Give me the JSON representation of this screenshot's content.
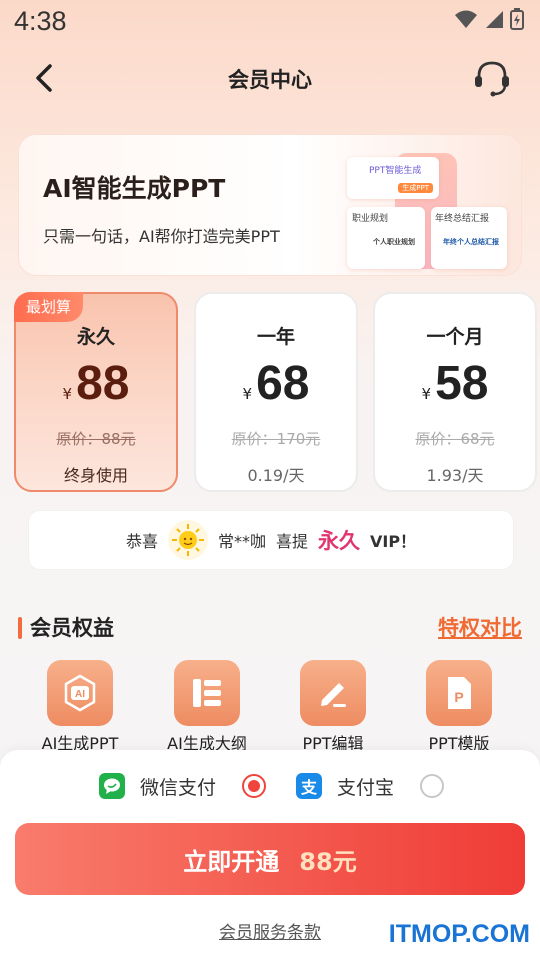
{
  "status": {
    "time": "4:38"
  },
  "nav": {
    "title": "会员中心"
  },
  "banner": {
    "title": "AI智能生成PPT",
    "subtitle": "只需一句话，AI帮你打造完美PPT",
    "art": {
      "card1_title": "PPT智能生成",
      "card1_btn": "生成PPT",
      "card2_title": "职业规划",
      "card2_text": "个人职业规划",
      "card3_title": "年终总结汇报",
      "card3_text": "年终个人总结汇报"
    }
  },
  "plans": [
    {
      "badge": "最划算",
      "name": "永久",
      "currency": "¥",
      "price": "88",
      "original": "原价：88元",
      "note": "终身使用",
      "selected": true
    },
    {
      "badge": "",
      "name": "一年",
      "currency": "¥",
      "price": "68",
      "original": "原价：170元",
      "note": "0.19/天",
      "selected": false
    },
    {
      "badge": "",
      "name": "一个月",
      "currency": "¥",
      "price": "58",
      "original": "原价：68元",
      "note": "1.93/天",
      "selected": false
    }
  ],
  "congrats": {
    "prefix": "恭喜",
    "user": "常**咖",
    "action": "喜提",
    "highlight": "永久",
    "suffix": "VIP！"
  },
  "benefits": {
    "title": "会员权益",
    "compare": "特权对比",
    "items": [
      {
        "label": "AI生成PPT",
        "icon": "ai-chip-icon"
      },
      {
        "label": "AI生成大纲",
        "icon": "outline-list-icon"
      },
      {
        "label": "PPT编辑",
        "icon": "edit-pen-icon"
      },
      {
        "label": "PPT模版",
        "icon": "ppt-file-icon"
      }
    ]
  },
  "payment": {
    "wechat_label": "微信支付",
    "alipay_label": "支付宝",
    "selected": "wechat",
    "button_label": "立即开通",
    "button_price": "88元",
    "terms": "会员服务条款"
  },
  "watermark": "ITMOP.COM",
  "colors": {
    "accent": "#ef3c36",
    "brand_orange": "#f06b34",
    "highlight_pink": "#e0356e"
  }
}
